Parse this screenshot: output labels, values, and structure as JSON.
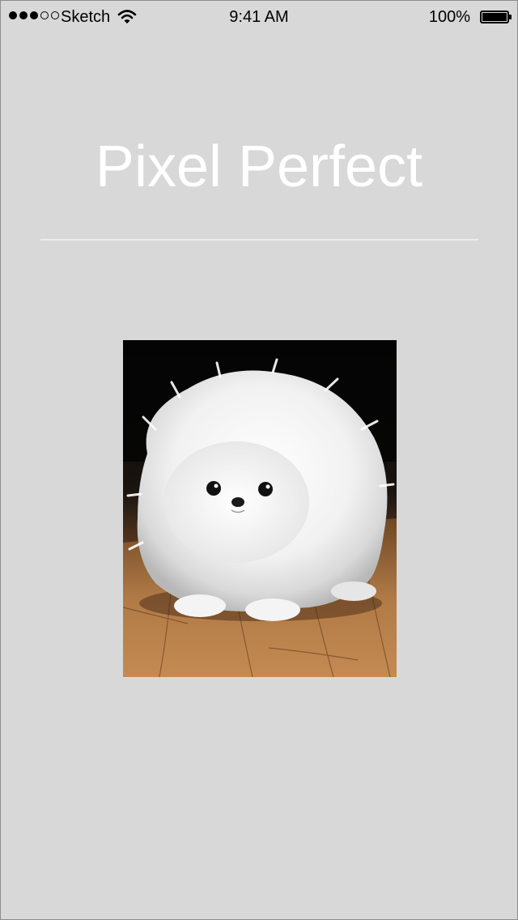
{
  "status_bar": {
    "signal_bars_filled": 3,
    "signal_bars_total": 5,
    "carrier": "Sketch",
    "time": "9:41 AM",
    "battery_percent": "100%",
    "battery_level": 1.0
  },
  "main": {
    "title": "Pixel Perfect",
    "image_subject": "white fluffy puppy on wooden floor"
  },
  "colors": {
    "background": "#d8d8d8",
    "title": "#ffffff",
    "divider": "#ececec"
  },
  "icons": [
    "signal-dot-icon",
    "wifi-icon",
    "battery-icon"
  ]
}
